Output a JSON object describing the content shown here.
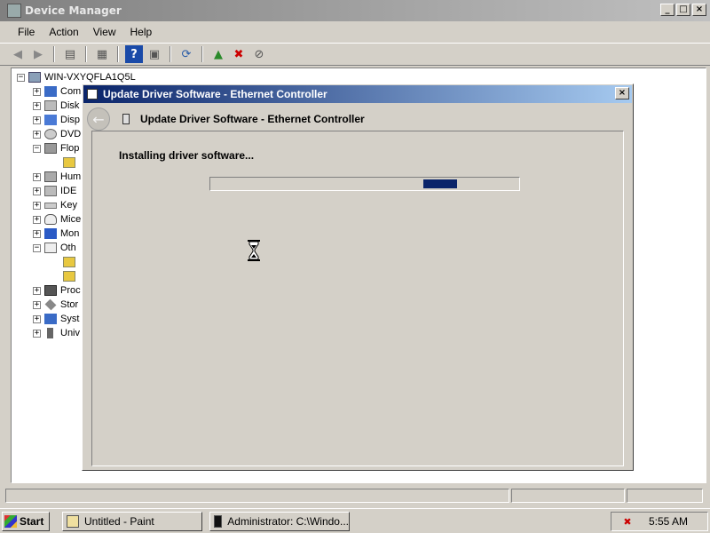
{
  "device_manager": {
    "title": "Device Manager",
    "menu": [
      "File",
      "Action",
      "View",
      "Help"
    ],
    "tree": {
      "root": "WIN-VXYQFLA1Q5L",
      "items": [
        "Com",
        "Disk",
        "Disp",
        "DVD",
        "Flop",
        "Hum",
        "IDE",
        "Key",
        "Mice",
        "Mon",
        "Oth",
        "Proc",
        "Stor",
        "Syst",
        "Univ"
      ]
    }
  },
  "dialog": {
    "title": "Update Driver Software - Ethernet Controller",
    "header": "Update Driver Software - Ethernet Controller",
    "status": "Installing driver software...",
    "progress_fraction": 0.11
  },
  "taskbar": {
    "start": "Start",
    "tasks": [
      "Untitled - Paint",
      "Administrator: C:\\Windo..."
    ],
    "clock": "5:55 AM"
  }
}
